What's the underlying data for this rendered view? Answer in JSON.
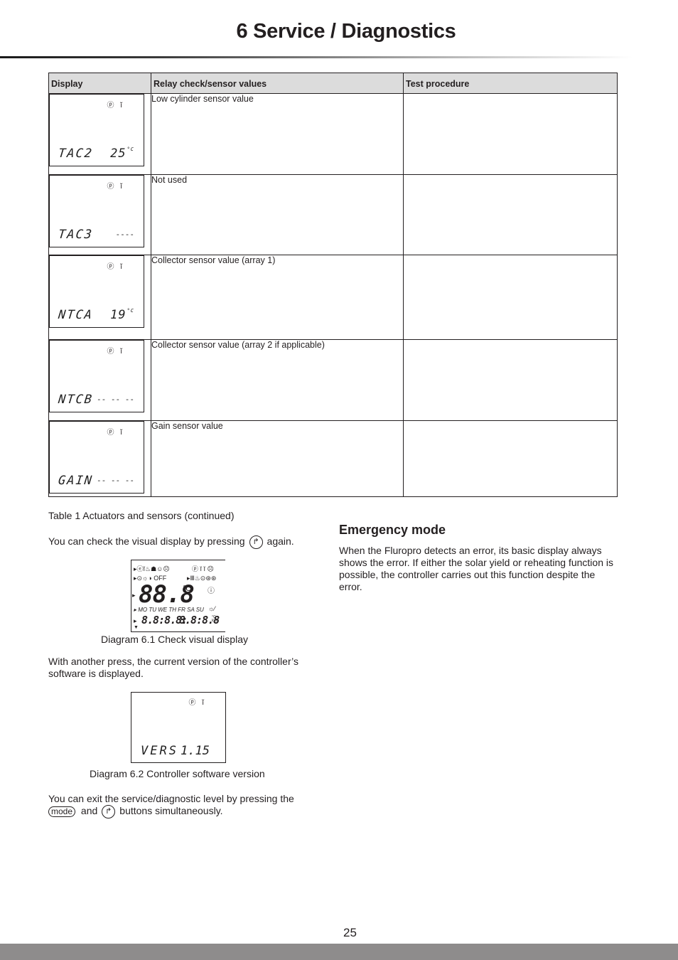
{
  "header": {
    "title": "6  Service / Diagnostics"
  },
  "table": {
    "columns": [
      "Display",
      "Relay check/sensor values",
      "Test procedure"
    ],
    "rows": [
      {
        "display": {
          "icons": "ⓟ ĭ",
          "label": "TAC2",
          "value": "25",
          "unit": "°C"
        },
        "relay": "Low cylinder sensor value",
        "test": ""
      },
      {
        "display": {
          "icons": "ⓟ ĭ",
          "label": "TAC3",
          "value": "----",
          "unit": ""
        },
        "relay": "Not used",
        "test": ""
      },
      {
        "display": {
          "icons": "ⓟ ĭ",
          "label": "NTCA",
          "value": "19",
          "unit": "°C"
        },
        "relay": "Collector sensor value (array 1)",
        "test": ""
      },
      {
        "display": {
          "icons": "ⓟ ĭ",
          "label": "NTCB",
          "value": "-- -- --",
          "unit": ""
        },
        "relay": "Collector sensor value (array 2 if applicable)",
        "test": ""
      },
      {
        "display": {
          "icons": "ⓟ ĭ",
          "label": "GAIN",
          "value": "-- -- --",
          "unit": ""
        },
        "relay": "Gain sensor value",
        "test": ""
      }
    ],
    "caption": "Table 1 Actuators and sensors (continued)"
  },
  "left": {
    "check_text_before": "You can check the visual display by pressing",
    "check_text_after": "again.",
    "diagram1": {
      "row1": "▸ⓔĭ♨☗☺☹",
      "row1_right": "ⓟ ĭ ĭ ☹",
      "row2": "▸⊙☼◑ OFF",
      "row2_right": "▸Ⅲ♨⊙⊛⊛",
      "big": "88.8",
      "big_unit": "°C",
      "info": "ⓘ",
      "days": "▸ MO TU WE TH FR SA SU",
      "days_right": "☼⁄",
      "segs_left": "8.8:8.8:",
      "segs_right": "8.8:8.8",
      "segs_unit": "°C kWh",
      "caption": "Diagram 6.1 Check visual display"
    },
    "version_text": "With another press, the current version of the controller’s software is displayed.",
    "diagram2": {
      "icons": "ⓟ ĭ",
      "label": "VERS",
      "value": "1.15",
      "caption": "Diagram 6.2 Controller software version"
    },
    "exit_text_before": "You can exit the service/diagnostic level by pressing the",
    "mode_button": "mode",
    "exit_and": "and",
    "exit_text_after": "buttons simultaneously.",
    "arrow_button_glyph": "↱"
  },
  "right": {
    "heading": "Emergency mode",
    "body": "When the Fluropro detects an error, its basic display always shows the error. If either the solar yield or reheating function is possible, the controller carries out this function despite the error."
  },
  "footer": {
    "page_number": "25"
  }
}
